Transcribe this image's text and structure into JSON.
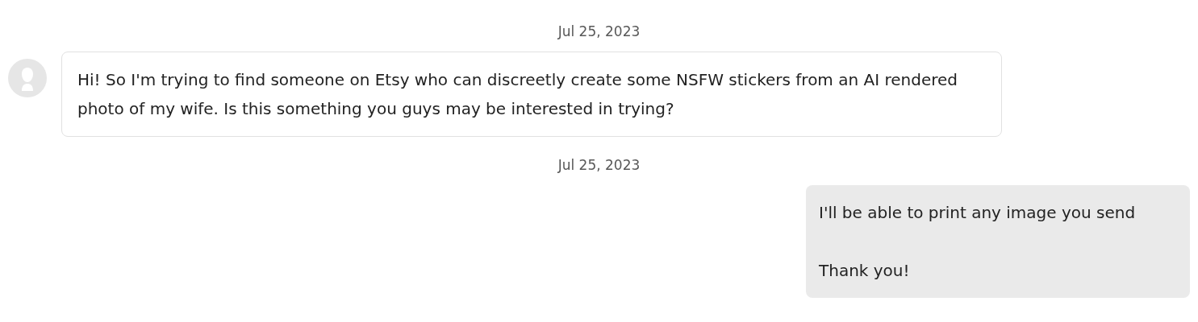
{
  "messages": [
    {
      "date": "Jul 25, 2023",
      "kind": "incoming",
      "text": "Hi! So I'm trying to find someone on Etsy who can discreetly create some NSFW stickers from an AI rendered photo of my wife. Is this something you guys may be interested in trying?"
    },
    {
      "date": "Jul 25, 2023",
      "kind": "outgoing",
      "text": "I'll be able to print any image you send\n\nThank you!"
    }
  ]
}
